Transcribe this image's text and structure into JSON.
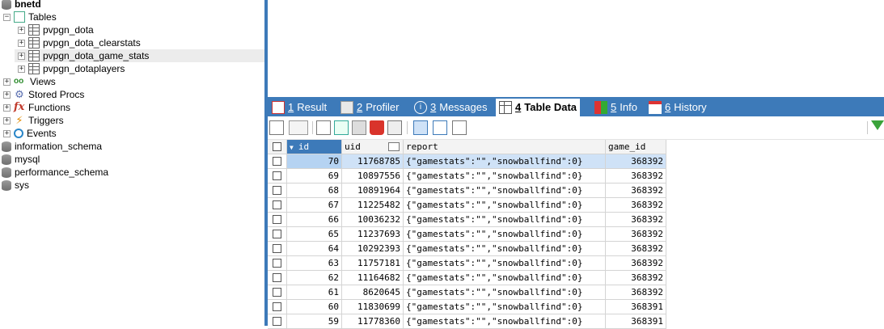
{
  "tree": {
    "db_bnetd": "bnetd",
    "tables_label": "Tables",
    "tables": [
      "pvpgn_dota",
      "pvpgn_dota_clearstats",
      "pvpgn_dota_game_stats",
      "pvpgn_dotaplayers"
    ],
    "views": "Views",
    "stored_procs": "Stored Procs",
    "functions": "Functions",
    "triggers": "Triggers",
    "events": "Events",
    "other_dbs": [
      "information_schema",
      "mysql",
      "performance_schema",
      "sys"
    ]
  },
  "tabs": [
    {
      "num": "1",
      "label": "Result"
    },
    {
      "num": "2",
      "label": "Profiler"
    },
    {
      "num": "3",
      "label": "Messages"
    },
    {
      "num": "4",
      "label": "Table Data"
    },
    {
      "num": "5",
      "label": "Info"
    },
    {
      "num": "6",
      "label": "History"
    }
  ],
  "columns": [
    "id",
    "uid",
    "report",
    "game_id"
  ],
  "rows": [
    {
      "id": "70",
      "uid": "11768785",
      "report": "{\"gamestats\":\"\",\"snowballfind\":0}",
      "game_id": "368392"
    },
    {
      "id": "69",
      "uid": "10897556",
      "report": "{\"gamestats\":\"\",\"snowballfind\":0}",
      "game_id": "368392"
    },
    {
      "id": "68",
      "uid": "10891964",
      "report": "{\"gamestats\":\"\",\"snowballfind\":0}",
      "game_id": "368392"
    },
    {
      "id": "67",
      "uid": "11225482",
      "report": "{\"gamestats\":\"\",\"snowballfind\":0}",
      "game_id": "368392"
    },
    {
      "id": "66",
      "uid": "10036232",
      "report": "{\"gamestats\":\"\",\"snowballfind\":0}",
      "game_id": "368392"
    },
    {
      "id": "65",
      "uid": "11237693",
      "report": "{\"gamestats\":\"\",\"snowballfind\":0}",
      "game_id": "368392"
    },
    {
      "id": "64",
      "uid": "10292393",
      "report": "{\"gamestats\":\"\",\"snowballfind\":0}",
      "game_id": "368392"
    },
    {
      "id": "63",
      "uid": "11757181",
      "report": "{\"gamestats\":\"\",\"snowballfind\":0}",
      "game_id": "368392"
    },
    {
      "id": "62",
      "uid": "11164682",
      "report": "{\"gamestats\":\"\",\"snowballfind\":0}",
      "game_id": "368392"
    },
    {
      "id": "61",
      "uid": "8620645",
      "report": "{\"gamestats\":\"\",\"snowballfind\":0}",
      "game_id": "368392"
    },
    {
      "id": "60",
      "uid": "11830699",
      "report": "{\"gamestats\":\"\",\"snowballfind\":0}",
      "game_id": "368391"
    },
    {
      "id": "59",
      "uid": "11778360",
      "report": "{\"gamestats\":\"\",\"snowballfind\":0}",
      "game_id": "368391"
    }
  ],
  "colors": {
    "accent": "#3d7ab9",
    "selected_row": "#cfe2f7"
  }
}
